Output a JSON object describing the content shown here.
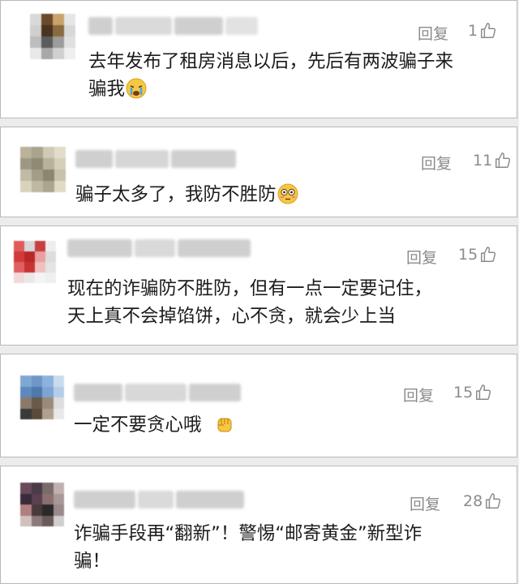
{
  "comments": [
    {
      "reply_label": "回复",
      "likes": "1",
      "text_lines": [
        "去年发布了租房消息以后，先后有两波骗子来",
        "骗我"
      ],
      "emoji": "crying-face"
    },
    {
      "reply_label": "回复",
      "likes": "11",
      "text_lines": [
        "骗子太多了，我防不胜防"
      ],
      "emoji": "flushed-face"
    },
    {
      "reply_label": "回复",
      "likes": "15",
      "text_lines": [
        "现在的诈骗防不胜防，但有一点一定要记住，",
        "天上真不会掉馅饼，心不贪，就会少上当"
      ]
    },
    {
      "reply_label": "回复",
      "likes": "15",
      "text_lines": [
        "一定不要贪心哦"
      ],
      "emoji": "raised-fist"
    },
    {
      "reply_label": "回复",
      "likes": "28",
      "text_lines": [
        "诈骗手段再“翻新”！警惕“邮寄黄金”新型诈",
        "骗！"
      ]
    }
  ],
  "colors": {
    "text": "#1c1c1c",
    "meta": "#8b8b8b",
    "border": "#b9b9b9",
    "background": "#ececec"
  }
}
